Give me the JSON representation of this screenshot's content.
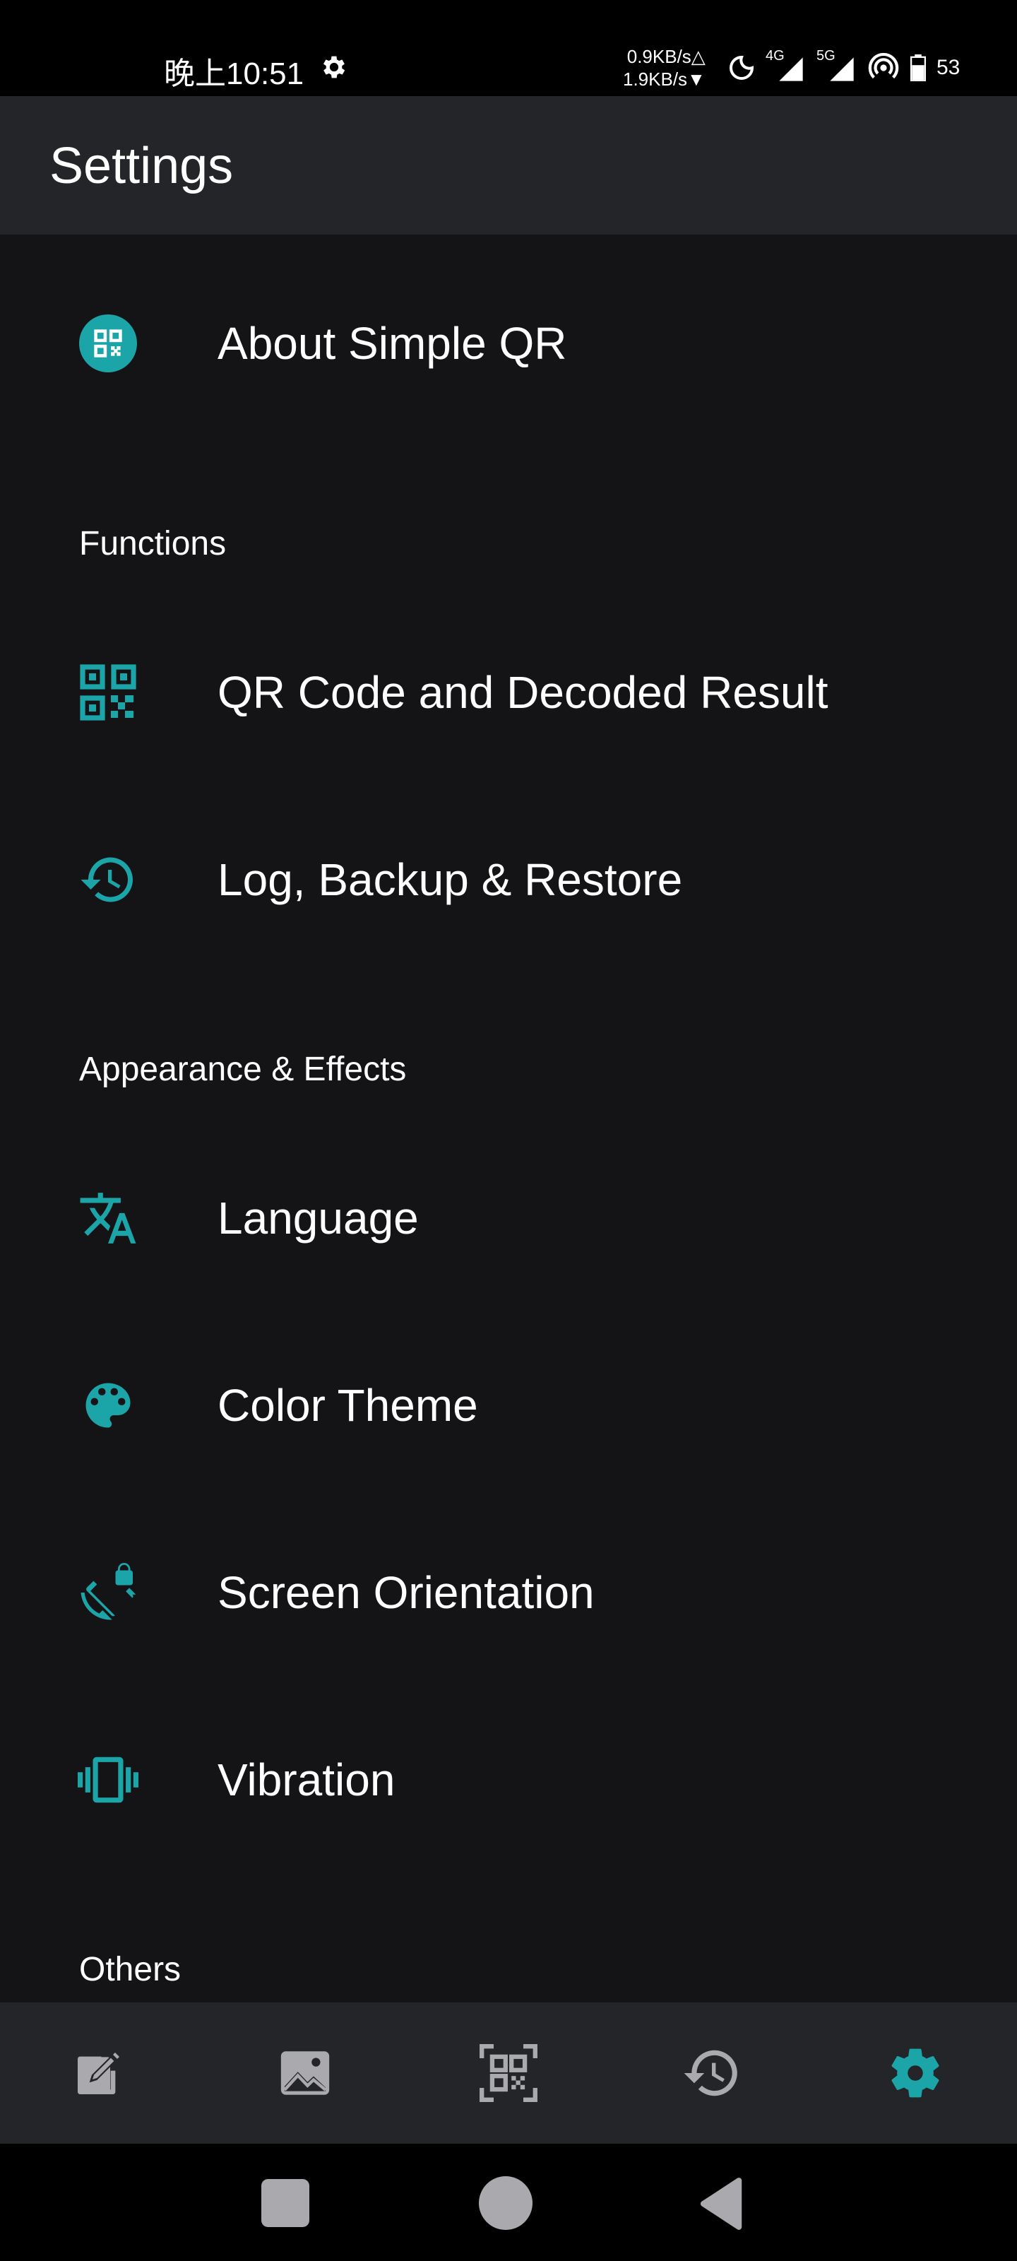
{
  "status_bar": {
    "time": "晚上10:51",
    "upload_speed": "0.9KB/s△",
    "download_speed": "1.9KB/s▼",
    "network_1": "4G",
    "network_2": "5G",
    "battery": "53"
  },
  "app_bar": {
    "title": "Settings"
  },
  "about": {
    "label": "About Simple QR",
    "icon": "qr-badge-icon"
  },
  "sections": {
    "functions": "Functions",
    "appearance": "Appearance & Effects",
    "others": "Others"
  },
  "items": {
    "qr_code_result": {
      "label": "QR Code and Decoded Result",
      "icon": "qr-code-icon"
    },
    "log_backup": {
      "label": "Log, Backup & Restore",
      "icon": "history-icon"
    },
    "language": {
      "label": "Language",
      "icon": "translate-icon"
    },
    "color_theme": {
      "label": "Color Theme",
      "icon": "palette-icon"
    },
    "screen_orientation": {
      "label": "Screen Orientation",
      "icon": "screen-rotation-lock-icon"
    },
    "vibration": {
      "label": "Vibration",
      "icon": "vibration-icon"
    }
  },
  "bottom_nav": [
    {
      "name": "generate",
      "icon": "edit-icon"
    },
    {
      "name": "image-scan",
      "icon": "image-icon"
    },
    {
      "name": "scan",
      "icon": "qr-scan-icon"
    },
    {
      "name": "history",
      "icon": "history-icon"
    },
    {
      "name": "settings",
      "icon": "gear-icon",
      "active": true
    }
  ],
  "colors": {
    "accent": "#1CA5A8",
    "background": "#141416",
    "bar": "#242529",
    "nav_inactive": "#A9A9AE"
  }
}
